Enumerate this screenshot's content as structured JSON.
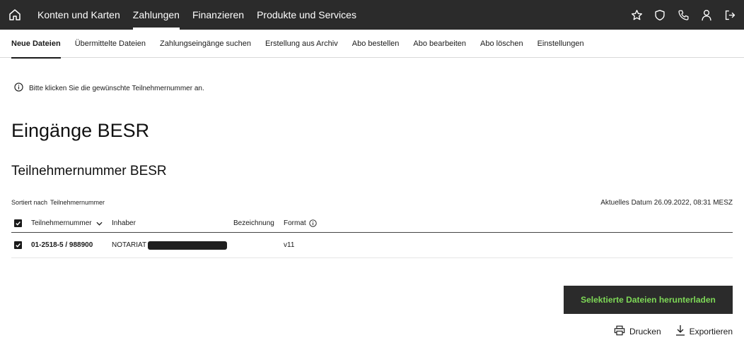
{
  "topbar": {
    "nav": [
      "Konten und Karten",
      "Zahlungen",
      "Finanzieren",
      "Produkte und Services"
    ],
    "active_index": 1
  },
  "subnav": {
    "items": [
      "Neue Dateien",
      "Übermittelte Dateien",
      "Zahlungseingänge suchen",
      "Erstellung aus Archiv",
      "Abo bestellen",
      "Abo bearbeiten",
      "Abo löschen",
      "Einstellungen"
    ],
    "active_index": 0
  },
  "info": {
    "text": "Bitte klicken Sie die gewünschte Teilnehmernummer an."
  },
  "page": {
    "title": "Eingänge BESR",
    "section_title": "Teilnehmernummer BESR"
  },
  "sort": {
    "label": "Sortiert nach",
    "value": "Teilnehmernummer"
  },
  "date": {
    "text": "Aktuelles Datum 26.09.2022, 08:31 MESZ"
  },
  "table": {
    "headers": {
      "nr": "Teilnehmernummer",
      "owner": "Inhaber",
      "desc": "Bezeichnung",
      "format": "Format"
    },
    "rows": [
      {
        "nr": "01-2518-5 / 988900",
        "owner": "NOTARIAT",
        "desc": "",
        "format": "v11"
      }
    ]
  },
  "actions": {
    "download": "Selektierte Dateien herunterladen",
    "print": "Drucken",
    "export": "Exportieren"
  },
  "colors": {
    "accent_green": "#7ed957",
    "bar": "#2b2b2b"
  }
}
